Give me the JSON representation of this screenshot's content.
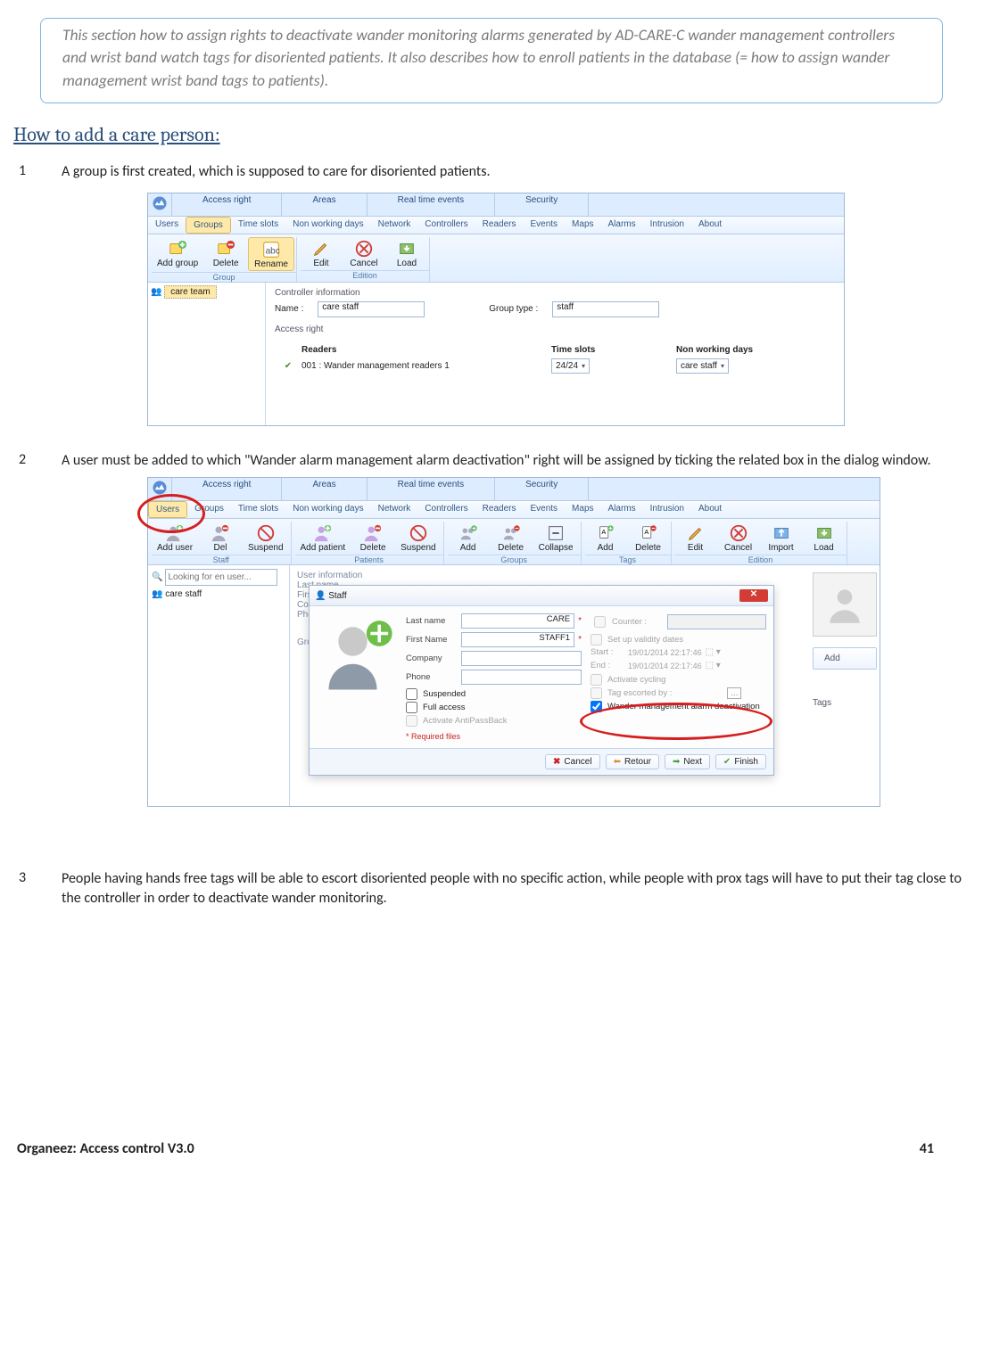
{
  "intro": "This section how to assign rights to deactivate wander monitoring alarms generated by AD-CARE-C wander management controllers and wrist band watch tags for disoriented patients. It also describes how to enroll patients in the database (= how to assign wander management wrist band tags to patients).",
  "heading": "How to add a care person:",
  "steps": {
    "s1": {
      "num": "1",
      "text": "A group is first created, which is supposed to care for disoriented patients."
    },
    "s2": {
      "num": "2",
      "text": "A user must be added to which \"Wander alarm management alarm deactivation\" right will be assigned by ticking the related box in the dialog window."
    },
    "s3": {
      "num": "3",
      "text": "People having hands free tags will be able to escort disoriented people with no specific action, while people with prox tags will have to put their tag close to the controller in order to deactivate wander monitoring."
    }
  },
  "shot1": {
    "topTabs": {
      "t1": "Access right",
      "t2": "Areas",
      "t3": "Real time events",
      "t4": "Security"
    },
    "subTabs": {
      "users": "Users",
      "groups": "Groups",
      "timeslots": "Time slots",
      "nwd": "Non working days",
      "network": "Network",
      "controllers": "Controllers",
      "readers": "Readers",
      "events": "Events",
      "maps": "Maps",
      "alarms": "Alarms",
      "intrusion": "Intrusion",
      "about": "About"
    },
    "ribbon": {
      "addgroup": "Add group",
      "delete": "Delete",
      "rename": "Rename",
      "edit": "Edit",
      "cancel": "Cancel",
      "load": "Load",
      "catGroup": "Group",
      "catEdition": "Edition"
    },
    "treeItem": "care team",
    "form": {
      "controllerInfo": "Controller information",
      "nameLbl": "Name :",
      "nameVal": "care staff",
      "groupTypeLbl": "Group type :",
      "groupTypeVal": "staff",
      "accessRight": "Access right",
      "colReaders": "Readers",
      "colSlots": "Time slots",
      "colNwd": "Non working days",
      "readerVal": "001 : Wander management readers 1",
      "slotsVal": "24/24",
      "nwdVal": "care staff"
    }
  },
  "shot2": {
    "ribbon": {
      "adduser": "Add user",
      "del": "Del",
      "suspend": "Suspend",
      "addpatient": "Add patient",
      "delete": "Delete",
      "suspend2": "Suspend",
      "add": "Add",
      "delete2": "Delete",
      "collapse": "Collapse",
      "add2": "Add",
      "delete3": "Delete",
      "edit": "Edit",
      "cancel": "Cancel",
      "import": "Import",
      "load": "Load",
      "catStaff": "Staff",
      "catPatients": "Patients",
      "catGroups": "Groups",
      "catTags": "Tags",
      "catEdition": "Edition"
    },
    "searchPH": "Looking for en user...",
    "treeItem": "care staff",
    "leftLbls": {
      "uinfo": "User information",
      "last": "Last name",
      "first": "First name",
      "company": "Company",
      "phone": "Phone",
      "groups": "Groups"
    },
    "sideBtns": {
      "add": "Add",
      "tags": "Tags"
    },
    "dlg": {
      "title": "Staff",
      "lastLbl": "Last name",
      "lastVal": "CARE",
      "firstLbl": "First Name",
      "firstVal": "STAFF1",
      "companyLbl": "Company",
      "phoneLbl": "Phone",
      "counterLbl": "Counter :",
      "validityLbl": "Set up validity dates",
      "startLbl": "Start :",
      "startVal": "19/01/2014 22:17:46",
      "endLbl": "End :",
      "endVal": "19/01/2014 22:17:46",
      "suspended": "Suspended",
      "fullAccess": "Full access",
      "apb": "Activate AntiPassBack",
      "cycling": "Activate cycling",
      "escorted": "Tag escorted by :",
      "wander": "Wander management  alarm deactivation",
      "reqNote": "* Required files",
      "btnCancel": "Cancel",
      "btnRetour": "Retour",
      "btnNext": "Next",
      "btnFinish": "Finish"
    }
  },
  "footer": {
    "left": "Organeez: Access control     V3.0",
    "right": "41"
  }
}
